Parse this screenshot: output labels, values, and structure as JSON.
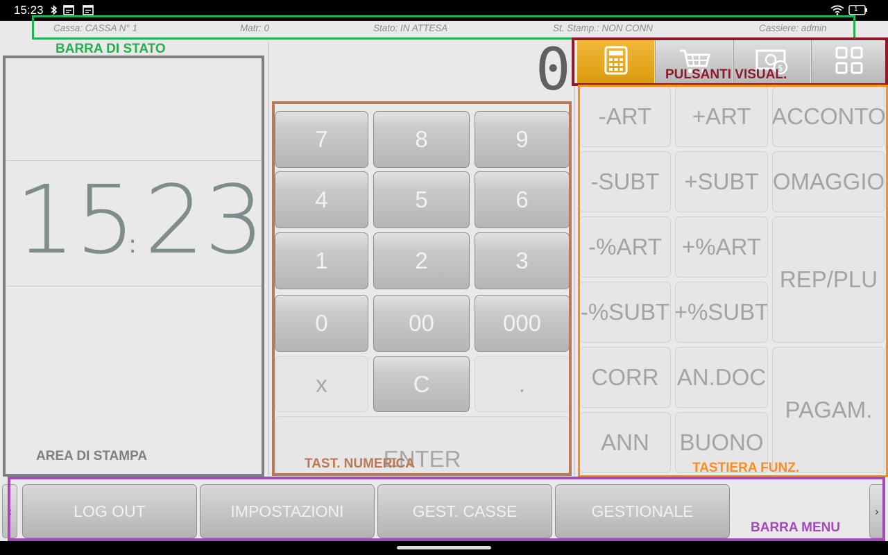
{
  "system_bar": {
    "time": "15:23",
    "icons": [
      "bluetooth-icon",
      "calendar-icon",
      "calendar-icon",
      "wifi-icon",
      "battery-icon"
    ],
    "battery_label": "1"
  },
  "status_bar": {
    "cassa": "Cassa: CASSA N° 1",
    "matr": "Matr: 0",
    "stato": "Stato: IN ATTESA",
    "stampante": "St. Stamp.: NON CONN",
    "cassiere": "Cassiere: admin"
  },
  "print_area": {
    "clock_hours": "15",
    "clock_separator": ":",
    "clock_minutes": "23"
  },
  "display": {
    "value": "0"
  },
  "numeric_keypad": {
    "keys": [
      "7",
      "8",
      "9",
      "4",
      "5",
      "6",
      "1",
      "2",
      "3",
      "0",
      "00",
      "000",
      "x",
      "C",
      ".",
      "ENTER"
    ]
  },
  "view_buttons": {
    "items": [
      {
        "icon": "calculator-icon",
        "active": true
      },
      {
        "icon": "cart-icon",
        "active": false
      },
      {
        "icon": "cash-icon",
        "active": false
      },
      {
        "icon": "grid-icon",
        "active": false
      }
    ]
  },
  "function_keys": {
    "keys": [
      "-ART",
      "+ART",
      "ACCONTO",
      "-SUBT",
      "+SUBT",
      "OMAGGIO",
      "-%ART",
      "+%ART",
      "REP/PLU",
      "-%SUBT",
      "+%SUBT",
      "CORR",
      "AN.DOC",
      "PAGAM.",
      "ANN",
      "BUONO"
    ]
  },
  "menu_bar": {
    "items": [
      "LOG OUT",
      "IMPOSTAZIONI",
      "GEST. CASSE",
      "GESTIONALE"
    ],
    "prev_arrow": "‹",
    "next_arrow": "›"
  },
  "annotations": {
    "status_bar": "BARRA DI STATO",
    "view_buttons": "PULSANTI VISUAL.",
    "print_area": "AREA DI STAMPA",
    "numeric_keypad": "TAST. NUMERICA",
    "function_keys": "TASTIERA FUNZ.",
    "menu_bar": "BARRA MENU"
  },
  "colors": {
    "annotation_status": "#22b14c",
    "annotation_view": "#8b1a2b",
    "annotation_print": "#7f7f7f",
    "annotation_numeric": "#b97a57",
    "annotation_function": "#ff8c1a",
    "annotation_menu": "#a347ba",
    "active_view": "#e5a516"
  }
}
